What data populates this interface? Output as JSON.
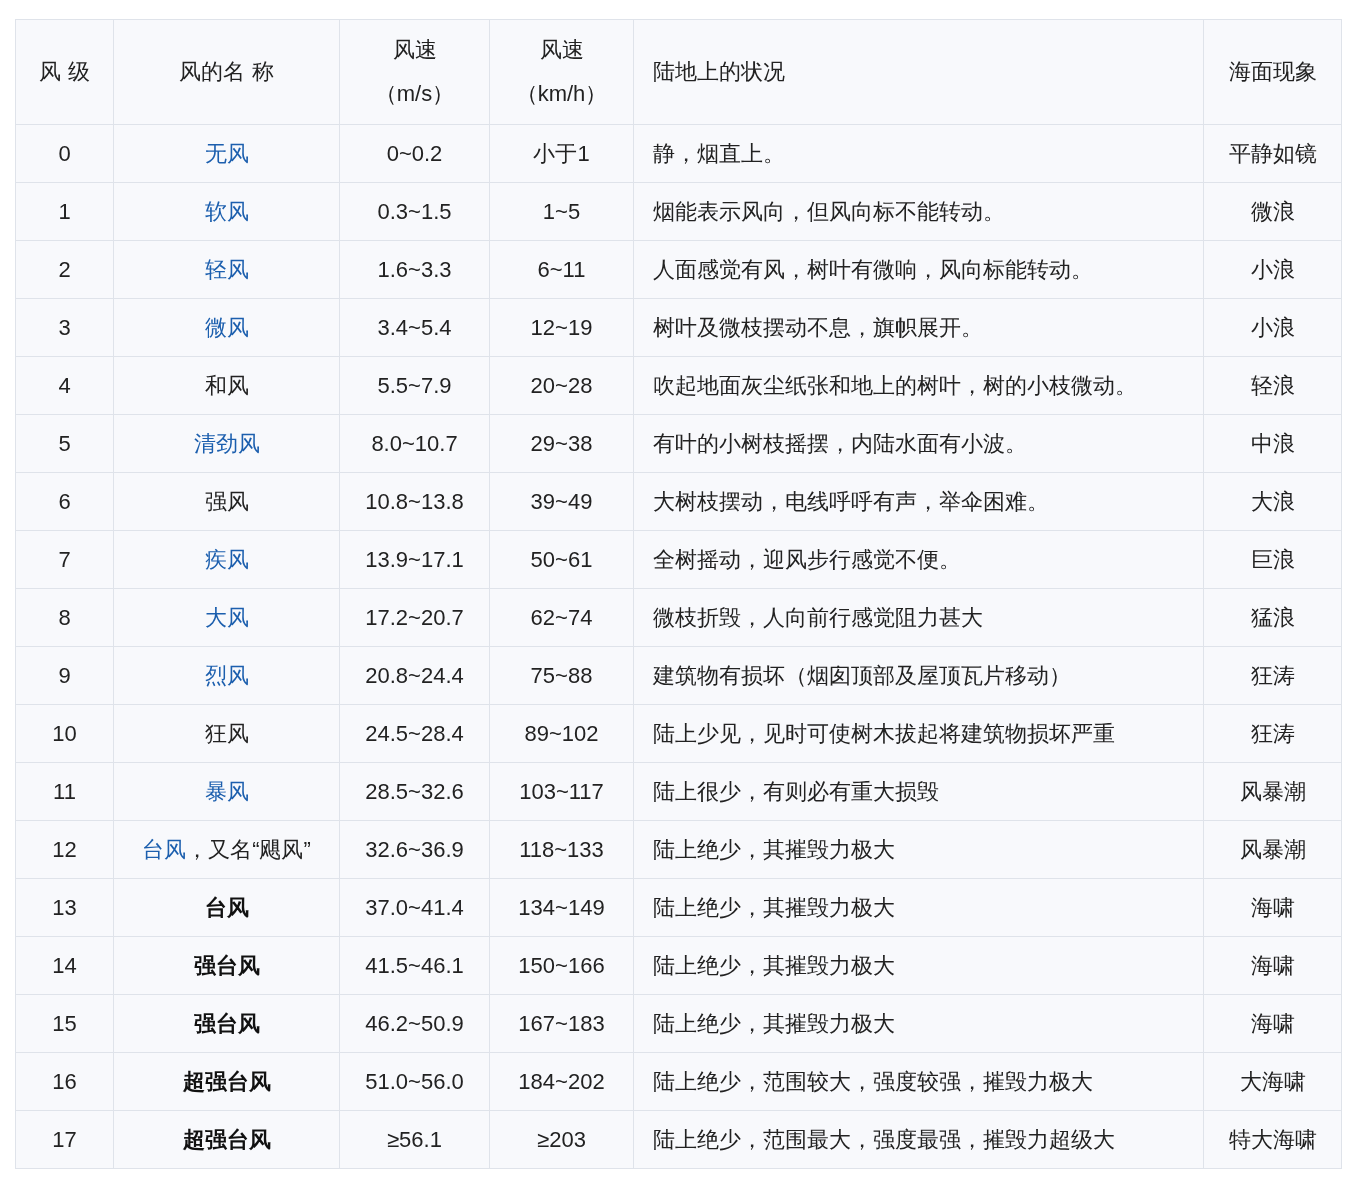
{
  "table": {
    "columns": [
      {
        "lines": [
          "风 级"
        ]
      },
      {
        "lines": [
          "风的名 称"
        ]
      },
      {
        "lines": [
          "风速",
          "（m/s）"
        ]
      },
      {
        "lines": [
          "风速",
          "（km/h）"
        ]
      },
      {
        "lines": [
          "陆地上的状况"
        ]
      },
      {
        "lines": [
          "海面现象"
        ]
      }
    ],
    "rows": [
      {
        "level": "0",
        "name": [
          {
            "text": "无风",
            "kind": "link"
          }
        ],
        "ms": "0~0.2",
        "kmh": "小于1",
        "land": "静，烟直上。",
        "sea": "平静如镜"
      },
      {
        "level": "1",
        "name": [
          {
            "text": "软风",
            "kind": "link"
          }
        ],
        "ms": "0.3~1.5",
        "kmh": "1~5",
        "land": "烟能表示风向，但风向标不能转动。",
        "sea": "微浪"
      },
      {
        "level": "2",
        "name": [
          {
            "text": "轻风",
            "kind": "link"
          }
        ],
        "ms": "1.6~3.3",
        "kmh": "6~11",
        "land": "人面感觉有风，树叶有微响，风向标能转动。",
        "sea": "小浪"
      },
      {
        "level": "3",
        "name": [
          {
            "text": "微风",
            "kind": "link"
          }
        ],
        "ms": "3.4~5.4",
        "kmh": "12~19",
        "land": "树叶及微枝摆动不息，旗帜展开。",
        "sea": "小浪"
      },
      {
        "level": "4",
        "name": [
          {
            "text": "和风",
            "kind": "plain"
          }
        ],
        "ms": "5.5~7.9",
        "kmh": "20~28",
        "land": "吹起地面灰尘纸张和地上的树叶，树的小枝微动。",
        "sea": "轻浪"
      },
      {
        "level": "5",
        "name": [
          {
            "text": "清劲风",
            "kind": "link"
          }
        ],
        "ms": "8.0~10.7",
        "kmh": "29~38",
        "land": "有叶的小树枝摇摆，内陆水面有小波。",
        "sea": "中浪"
      },
      {
        "level": "6",
        "name": [
          {
            "text": "强风",
            "kind": "plain"
          }
        ],
        "ms": "10.8~13.8",
        "kmh": "39~49",
        "land": "大树枝摆动，电线呼呼有声，举伞困难。",
        "sea": "大浪"
      },
      {
        "level": "7",
        "name": [
          {
            "text": "疾风",
            "kind": "link"
          }
        ],
        "ms": "13.9~17.1",
        "kmh": "50~61",
        "land": "全树摇动，迎风步行感觉不便。",
        "sea": "巨浪"
      },
      {
        "level": "8",
        "name": [
          {
            "text": "大风",
            "kind": "link"
          }
        ],
        "ms": "17.2~20.7",
        "kmh": "62~74",
        "land": "微枝折毁，人向前行感觉阻力甚大",
        "sea": "猛浪"
      },
      {
        "level": "9",
        "name": [
          {
            "text": "烈风",
            "kind": "link"
          }
        ],
        "ms": "20.8~24.4",
        "kmh": "75~88",
        "land": "建筑物有损坏（烟囱顶部及屋顶瓦片移动）",
        "sea": "狂涛"
      },
      {
        "level": "10",
        "name": [
          {
            "text": "狂风",
            "kind": "plain"
          }
        ],
        "ms": "24.5~28.4",
        "kmh": "89~102",
        "land": "陆上少见，见时可使树木拔起将建筑物损坏严重",
        "sea": "狂涛"
      },
      {
        "level": "11",
        "name": [
          {
            "text": "暴风",
            "kind": "link"
          }
        ],
        "ms": "28.5~32.6",
        "kmh": "103~117",
        "land": "陆上很少，有则必有重大损毁",
        "sea": "风暴潮"
      },
      {
        "level": "12",
        "name": [
          {
            "text": "台风",
            "kind": "link"
          },
          {
            "text": "，又名“飓风”",
            "kind": "plain"
          }
        ],
        "ms": "32.6~36.9",
        "kmh": "118~133",
        "land": "陆上绝少，其摧毁力极大",
        "sea": "风暴潮"
      },
      {
        "level": "13",
        "name": [
          {
            "text": "台风",
            "kind": "bold"
          }
        ],
        "ms": "37.0~41.4",
        "kmh": "134~149",
        "land": "陆上绝少，其摧毁力极大",
        "sea": "海啸"
      },
      {
        "level": "14",
        "name": [
          {
            "text": "强台风",
            "kind": "bold"
          }
        ],
        "ms": "41.5~46.1",
        "kmh": "150~166",
        "land": "陆上绝少，其摧毁力极大",
        "sea": "海啸"
      },
      {
        "level": "15",
        "name": [
          {
            "text": "强台风",
            "kind": "bold"
          }
        ],
        "ms": "46.2~50.9",
        "kmh": "167~183",
        "land": "陆上绝少，其摧毁力极大",
        "sea": "海啸"
      },
      {
        "level": "16",
        "name": [
          {
            "text": "超强台风",
            "kind": "bold"
          }
        ],
        "ms": "51.0~56.0",
        "kmh": "184~202",
        "land": "陆上绝少，范围较大，强度较强，摧毁力极大",
        "sea": "大海啸"
      },
      {
        "level": "17",
        "name": [
          {
            "text": "超强台风",
            "kind": "bold"
          }
        ],
        "ms": "≥56.1",
        "kmh": "≥203",
        "land": "陆上绝少，范围最大，强度最强，摧毁力超级大",
        "sea": "特大海啸"
      }
    ]
  }
}
